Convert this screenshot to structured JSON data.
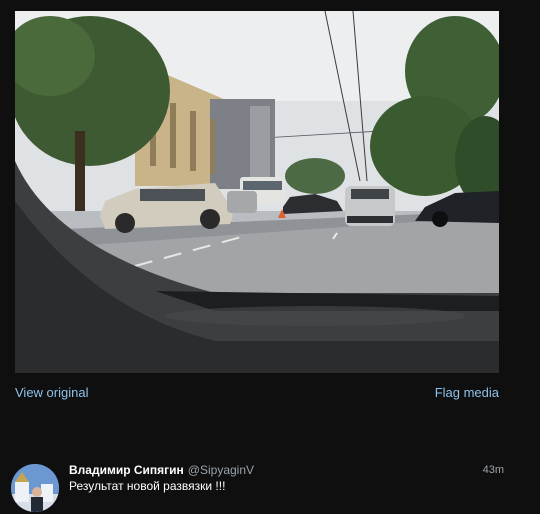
{
  "media": {
    "alt": "",
    "view_original_label": "View original",
    "flag_label": "Flag media"
  },
  "tweet": {
    "author_name": "Владимир Сипягин",
    "author_handle": "@SipyaginV",
    "timestamp": "43m",
    "text": "Результат новой развязки !!!"
  },
  "colors": {
    "background": "#0f0f0f",
    "link": "#8ec1ea",
    "secondary_text": "#9aa3ab"
  }
}
